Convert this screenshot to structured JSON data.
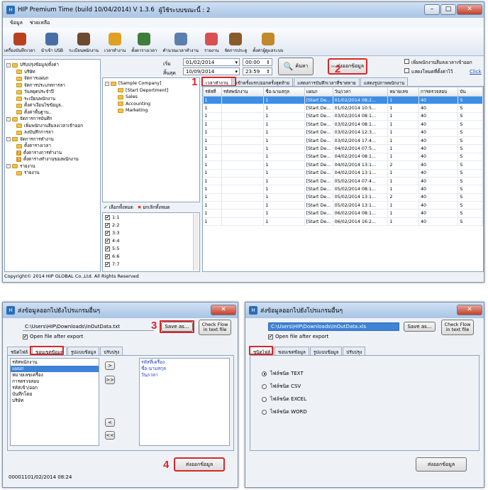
{
  "main_window": {
    "title": "HIP Premium Time (build 10/04/2014) V 1.3.6",
    "title_users": "ผู้ใช้ระบบขณะนี้ : 2",
    "menu": [
      "ข้อมูล",
      "ช่วยเหลือ"
    ],
    "toolbar": [
      {
        "label": "เครื่องบันทึกเวลา",
        "icon": "clock-machine-icon",
        "color": "#b8421f"
      },
      {
        "label": "นำเข้า USB",
        "icon": "usb-icon",
        "color": "#4a6fa5"
      },
      {
        "label": "ระเบียนพนักงาน",
        "icon": "employees-icon",
        "color": "#6b4a2e"
      },
      {
        "label": "เวลาทำงาน",
        "icon": "worktime-icon",
        "color": "#e0a020"
      },
      {
        "label": "ตั้งตารางเวลา",
        "icon": "calendar-icon",
        "color": "#3f7d3b"
      },
      {
        "label": "คำนวณเวลาทำงาน",
        "icon": "calculate-icon",
        "color": "#5c7fb0"
      },
      {
        "label": "รายงาน",
        "icon": "report-icon",
        "color": "#d94f4f"
      },
      {
        "label": "จัดการประตู",
        "icon": "door-icon",
        "color": "#8a5a2b"
      },
      {
        "label": "ตั้งค่าผู้ดูแลระบบ",
        "icon": "admin-icon",
        "color": "#c08a2a"
      }
    ],
    "nav_tree": [
      {
        "label": "ปรับปรุงข้อมูล/ตั้งค่า",
        "level": 0,
        "expander": "-"
      },
      {
        "label": "บริษัท",
        "level": 1
      },
      {
        "label": "จัดการแผนก",
        "level": 1
      },
      {
        "label": "จัดการประเภทการลา",
        "level": 1
      },
      {
        "label": "วันหยุดประจำปี",
        "level": 1
      },
      {
        "label": "ระเบียนพนักงาน",
        "level": 1
      },
      {
        "label": "ตั้งค่าเงื่อนไขข้อมูล..",
        "level": 1
      },
      {
        "label": "ตั้งค่าพื้นฐาน..",
        "level": 1
      },
      {
        "label": "จัดการการบันทึก",
        "level": 0,
        "expander": "-"
      },
      {
        "label": "เพิ่มพนักงานลืมลงเวลาเข้าออก",
        "level": 1
      },
      {
        "label": "ลงบันทึกการลา",
        "level": 1
      },
      {
        "label": "จัดการการทำงาน",
        "level": 0,
        "expander": "-"
      },
      {
        "label": "ตั้งตารางเวลา",
        "level": 1
      },
      {
        "label": "ตั้งตารางการทำงาน",
        "level": 1,
        "badge": "2"
      },
      {
        "label": "ตั้งตารางทำงานของพนักงาน",
        "level": 1,
        "badge": "3"
      },
      {
        "label": "รายงาน",
        "level": 0,
        "expander": "-"
      },
      {
        "label": "รายงาน",
        "level": 1
      }
    ],
    "filter": {
      "start_label": "เริ่ม",
      "end_label": "สิ้นสุด",
      "start_date": "01/02/2014",
      "start_time": "00:00",
      "end_date": "10/09/2014",
      "end_time": "23:59",
      "search_button": "ค้นหา",
      "export_button": "ส่งออกข้อมูล",
      "opt_forgot": "เพิ่มพนักงานลืมลงเวลาเข้าออก",
      "opt_hide_photo": "แสดงโหมดที่ตั้งค่าไว้",
      "click_link": "Click"
    },
    "dept_tree": [
      "[Sample Company]",
      "[Start Deportment]",
      "Sales",
      "Accounting",
      "Marketing"
    ],
    "select_all": "เลือกทั้งหมด",
    "deselect_all": "ยกเลิกทั้งหมด",
    "checklist": [
      "1:1",
      "2:2",
      "3:3",
      "4:4",
      "5:5",
      "6:6",
      "7:7"
    ],
    "tabs": [
      "เวลาทำงาน",
      "เข้าครั้งแรก/ออกครั้งสุดท้าย",
      "แสดงการบันทึกเวลาที่ขาดหาย",
      "แสดงรูปภาพพนักงาน"
    ],
    "grid_headers": [
      "รหัสที่",
      "รหัสพนักงาน",
      "ชื่อ-นามสกุล",
      "แผนก",
      "วัน/เวลา",
      "หมายเลข",
      "การตรวจสอบ",
      "บัน"
    ],
    "grid_rows": [
      [
        "1",
        "",
        "1",
        "[Start De...",
        "01/02/2014 08:2...",
        "1",
        "40",
        "S"
      ],
      [
        "1",
        "",
        "1",
        "[Start De...",
        "01/02/2014 10:5...",
        "1",
        "40",
        "S"
      ],
      [
        "1",
        "",
        "1",
        "[Start De...",
        "03/02/2014 08:1...",
        "1",
        "40",
        "S"
      ],
      [
        "1",
        "",
        "1",
        "[Start De...",
        "03/02/2014 08:1...",
        "1",
        "40",
        "S"
      ],
      [
        "1",
        "",
        "1",
        "[Start De...",
        "03/02/2014 12:3...",
        "1",
        "40",
        "S"
      ],
      [
        "1",
        "",
        "1",
        "[Start De...",
        "03/02/2014 17:4...",
        "1",
        "40",
        "S"
      ],
      [
        "1",
        "",
        "1",
        "[Start De...",
        "04/02/2014 07:5...",
        "1",
        "40",
        "S"
      ],
      [
        "1",
        "",
        "1",
        "[Start De...",
        "04/02/2014 08:1...",
        "1",
        "40",
        "S"
      ],
      [
        "1",
        "",
        "1",
        "[Start De...",
        "04/02/2014 13:1...",
        "2",
        "40",
        "S"
      ],
      [
        "1",
        "",
        "1",
        "[Start De...",
        "04/02/2014 13:1...",
        "1",
        "40",
        "S"
      ],
      [
        "1",
        "",
        "1",
        "[Start De...",
        "05/02/2014 07:4...",
        "1",
        "40",
        "S"
      ],
      [
        "1",
        "",
        "1",
        "[Start De...",
        "05/02/2014 08:1...",
        "1",
        "40",
        "S"
      ],
      [
        "1",
        "",
        "1",
        "[Start De...",
        "05/02/2014 13:1...",
        "2",
        "40",
        "S"
      ],
      [
        "1",
        "",
        "1",
        "[Start De...",
        "05/02/2014 13:1...",
        "1",
        "40",
        "S"
      ],
      [
        "1",
        "",
        "1",
        "[Start De...",
        "06/02/2014 08:1...",
        "1",
        "40",
        "S"
      ],
      [
        "1",
        "",
        "1",
        "[Start De...",
        "06/02/2014 16:2...",
        "1",
        "40",
        "S"
      ]
    ],
    "footer": "Copyright© 2014 HIP GLOBAL Co.,Ltd. All Rights Reserved"
  },
  "dialog_left": {
    "title": "ส่งข้อมูลออกไปยังโปรแกรมอื่นๆ",
    "path": "C:\\Users\\HIP\\Downloads\\InOutData.txt",
    "save_as": "Save as...",
    "check_flow": "Check Flow in text file",
    "open_after": "Open file after export",
    "tabs": [
      "ชนิดไฟล์",
      "ขอบเขตข้อมูล",
      "รูปแบบข้อมูล",
      "ปรับปรุง"
    ],
    "available_fields": [
      "รหัสพนักงาน",
      "แผนก",
      "หมายเลขเครื่อง",
      "การตรวจสอบ",
      "รหัสเข้า/ออก",
      "บันทึกโดย",
      "บริษัท"
    ],
    "selected_fields": [
      "รหัสที่เครื่อง",
      "ชื่อ-นามสกุล",
      "วัน/เวลา"
    ],
    "move_buttons": [
      ">",
      ">>",
      "<",
      "<<"
    ],
    "export_button": "ส่งออกข้อมูล",
    "status": "00001101/02/2014 08:24"
  },
  "dialog_right": {
    "title": "ส่งข้อมูลออกไปยังโปรแกรมอื่นๆ",
    "path": "C:\\Users\\HIP\\Downloads\\InOutData.xls",
    "save_as": "Save as...",
    "check_flow": "Check Flow in text file",
    "open_after": "Open file after export",
    "tabs": [
      "ชนิดไฟล์",
      "ขอบเขตข้อมูล",
      "รูปแบบข้อมูล",
      "ปรับปรุง"
    ],
    "file_types": [
      "ไฟล์ชนิด TEXT",
      "ไฟล์ชนิด CSV",
      "ไฟล์ชนิด EXCEL",
      "ไฟล์ชนิด WORD"
    ],
    "export_button": "ส่งออกข้อมูล"
  },
  "callouts": [
    "1",
    "2",
    "3",
    "4"
  ],
  "accent": "#d9262a"
}
